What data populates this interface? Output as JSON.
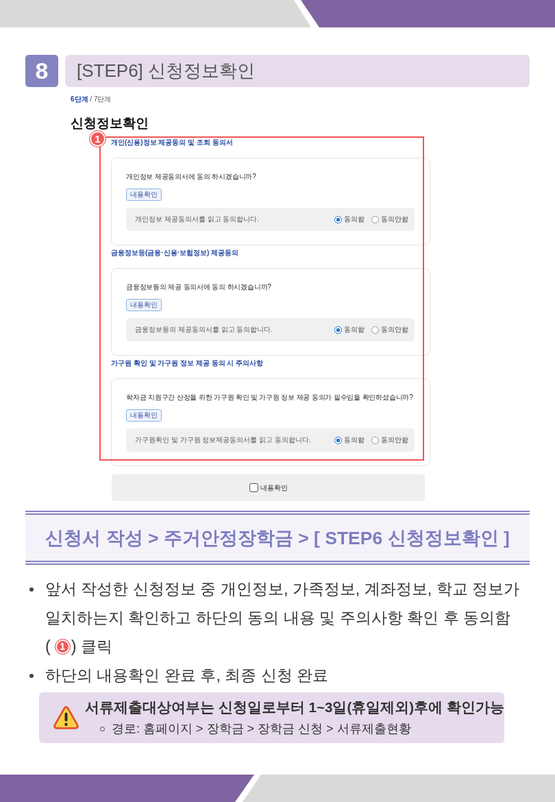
{
  "section": {
    "number": "8",
    "title": "[STEP6] 신청정보확인"
  },
  "form": {
    "step": {
      "current": "6단계",
      "rest": "/ 7단계"
    },
    "heading": "신청정보확인",
    "callout": "1",
    "agreements": [
      {
        "title": "개인(신용)정보 제공동의 및 조회 동의서",
        "question": "개인정보 제공동의서에 동의 하시겠습니까?",
        "button": "내용확인",
        "statement": "개인정보 제공동의서를 읽고 동의합니다.",
        "options": [
          {
            "label": "동의함",
            "selected": true
          },
          {
            "label": "동의안함",
            "selected": false
          }
        ]
      },
      {
        "title": "금융정보등(금융·신용·보험정보) 제공동의",
        "question": "금융정보등의 제공 동의서에 동의 하시겠습니까?",
        "button": "내용확인",
        "statement": "금융정보등의 제공동의서를 읽고 동의합니다.",
        "options": [
          {
            "label": "동의함",
            "selected": true
          },
          {
            "label": "동의안함",
            "selected": false
          }
        ]
      },
      {
        "title": "가구원 확인 및 가구원 정보 제공 동의 시 주의사항",
        "question": "학자금 지원구간 산정을 위한 가구원 확인 및 가구원 정보 제공 동의가 필수임을 확인하셨습니까?",
        "button": "내용확인",
        "statement": "가구원확인 및 가구원 정보제공동의서를 읽고 동의합니다.",
        "options": [
          {
            "label": "동의함",
            "selected": true
          },
          {
            "label": "동의안함",
            "selected": false
          }
        ]
      }
    ],
    "confirm": {
      "label": "내용확인",
      "checked": false
    }
  },
  "caption": "신청서 작성 > 주거안정장학금 > [ STEP6 신청정보확인 ]",
  "bullets": [
    {
      "kind": "callout",
      "lines": [
        "앞서 작성한 신청정보 중 개인정보, 가족정보, 계좌정보, 학교 정보가",
        "일치하는지 확인하고 하단의 동의 내용 및 주의사항 확인 후 동의함"
      ],
      "open": "(",
      "callout": "1",
      "close": ") 클릭"
    },
    {
      "kind": "text",
      "lines": [
        "하단의 내용확인 완료 후, 최종 신청 완료"
      ]
    }
  ],
  "notice": {
    "title": "서류제출대상여부는 신청일로부터 1~3일(휴일제외)후에 확인가능",
    "items": [
      "경로: 홈페이지 > 장학금 > 장학금 신청 > 서류제출현황"
    ]
  }
}
